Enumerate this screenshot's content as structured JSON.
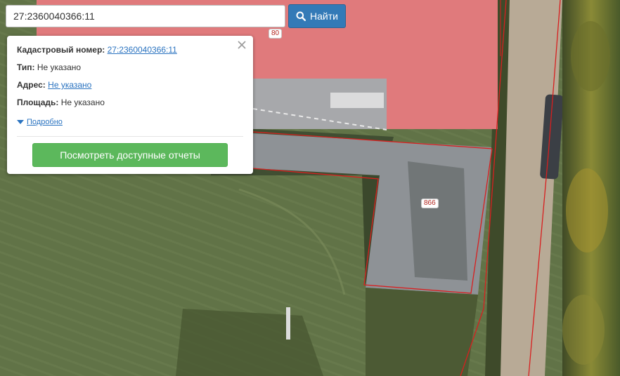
{
  "search": {
    "value": "27:2360040366:11",
    "button_label": "Найти",
    "button_icon": "search-icon"
  },
  "map": {
    "parcel_labels": [
      "80",
      "866"
    ],
    "colors": {
      "roof": "#e07a7c",
      "parcel_boundary": "#d81f1f",
      "field": "#5f6f45",
      "lot": "#8a8f92",
      "road": "#b9ab98",
      "trees": "#4f5a2c"
    }
  },
  "popup": {
    "cadastral_label": "Кадастровый номер:",
    "cadastral_value": "27:2360040366:11",
    "type_label": "Тип:",
    "type_value": "Не указано",
    "address_label": "Адрес:",
    "address_value": "Не указано",
    "area_label": "Площадь:",
    "area_value": "Не указано",
    "details_label": "Подробно",
    "reports_button": "Посмотреть доступные отчеты",
    "accent_color": "#5cb85c"
  }
}
